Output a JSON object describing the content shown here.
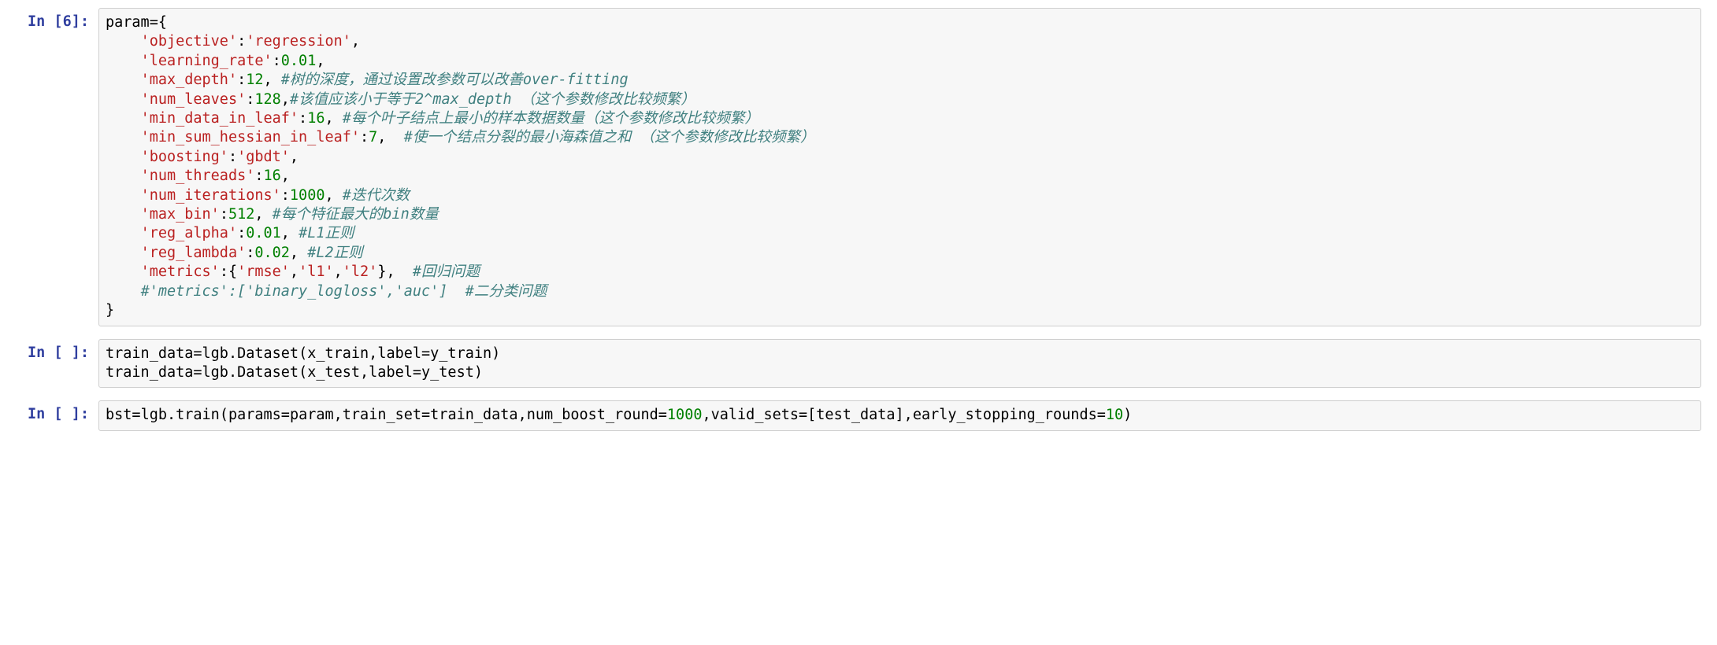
{
  "cells": [
    {
      "prompt_label": "In",
      "prompt_num": "6",
      "lines": [
        [
          {
            "t": "name",
            "v": "param"
          },
          {
            "t": "op",
            "v": "="
          },
          {
            "t": "punct",
            "v": "{"
          }
        ],
        [
          {
            "t": "plain",
            "v": "    "
          },
          {
            "t": "str",
            "v": "'objective'"
          },
          {
            "t": "punct",
            "v": ":"
          },
          {
            "t": "str",
            "v": "'regression'"
          },
          {
            "t": "punct",
            "v": ","
          }
        ],
        [
          {
            "t": "plain",
            "v": "    "
          },
          {
            "t": "str",
            "v": "'learning_rate'"
          },
          {
            "t": "punct",
            "v": ":"
          },
          {
            "t": "num",
            "v": "0.01"
          },
          {
            "t": "punct",
            "v": ","
          }
        ],
        [
          {
            "t": "plain",
            "v": "    "
          },
          {
            "t": "str",
            "v": "'max_depth'"
          },
          {
            "t": "punct",
            "v": ":"
          },
          {
            "t": "num",
            "v": "12"
          },
          {
            "t": "punct",
            "v": ", "
          },
          {
            "t": "comment",
            "v": "#树的深度，通过设置改参数可以改善over-fitting"
          }
        ],
        [
          {
            "t": "plain",
            "v": "    "
          },
          {
            "t": "str",
            "v": "'num_leaves'"
          },
          {
            "t": "punct",
            "v": ":"
          },
          {
            "t": "num",
            "v": "128"
          },
          {
            "t": "punct",
            "v": ","
          },
          {
            "t": "comment",
            "v": "#该值应该小于等于2^max_depth （这个参数修改比较频繁）"
          }
        ],
        [
          {
            "t": "plain",
            "v": "    "
          },
          {
            "t": "str",
            "v": "'min_data_in_leaf'"
          },
          {
            "t": "punct",
            "v": ":"
          },
          {
            "t": "num",
            "v": "16"
          },
          {
            "t": "punct",
            "v": ", "
          },
          {
            "t": "comment",
            "v": "#每个叶子结点上最小的样本数据数量（这个参数修改比较频繁）"
          }
        ],
        [
          {
            "t": "plain",
            "v": "    "
          },
          {
            "t": "str",
            "v": "'min_sum_hessian_in_leaf'"
          },
          {
            "t": "punct",
            "v": ":"
          },
          {
            "t": "num",
            "v": "7"
          },
          {
            "t": "punct",
            "v": ",  "
          },
          {
            "t": "comment",
            "v": "#使一个结点分裂的最小海森值之和 （这个参数修改比较频繁）"
          }
        ],
        [
          {
            "t": "plain",
            "v": "    "
          },
          {
            "t": "str",
            "v": "'boosting'"
          },
          {
            "t": "punct",
            "v": ":"
          },
          {
            "t": "str",
            "v": "'gbdt'"
          },
          {
            "t": "punct",
            "v": ","
          }
        ],
        [
          {
            "t": "plain",
            "v": "    "
          },
          {
            "t": "str",
            "v": "'num_threads'"
          },
          {
            "t": "punct",
            "v": ":"
          },
          {
            "t": "num",
            "v": "16"
          },
          {
            "t": "punct",
            "v": ","
          }
        ],
        [
          {
            "t": "plain",
            "v": "    "
          },
          {
            "t": "str",
            "v": "'num_iterations'"
          },
          {
            "t": "punct",
            "v": ":"
          },
          {
            "t": "num",
            "v": "1000"
          },
          {
            "t": "punct",
            "v": ", "
          },
          {
            "t": "comment",
            "v": "#迭代次数"
          }
        ],
        [
          {
            "t": "plain",
            "v": "    "
          },
          {
            "t": "str",
            "v": "'max_bin'"
          },
          {
            "t": "punct",
            "v": ":"
          },
          {
            "t": "num",
            "v": "512"
          },
          {
            "t": "punct",
            "v": ", "
          },
          {
            "t": "comment",
            "v": "#每个特征最大的bin数量"
          }
        ],
        [
          {
            "t": "plain",
            "v": "    "
          },
          {
            "t": "str",
            "v": "'reg_alpha'"
          },
          {
            "t": "punct",
            "v": ":"
          },
          {
            "t": "num",
            "v": "0.01"
          },
          {
            "t": "punct",
            "v": ", "
          },
          {
            "t": "comment",
            "v": "#L1正则"
          }
        ],
        [
          {
            "t": "plain",
            "v": "    "
          },
          {
            "t": "str",
            "v": "'reg_lambda'"
          },
          {
            "t": "punct",
            "v": ":"
          },
          {
            "t": "num",
            "v": "0.02"
          },
          {
            "t": "punct",
            "v": ", "
          },
          {
            "t": "comment",
            "v": "#L2正则"
          }
        ],
        [
          {
            "t": "plain",
            "v": "    "
          },
          {
            "t": "str",
            "v": "'metrics'"
          },
          {
            "t": "punct",
            "v": ":{"
          },
          {
            "t": "str",
            "v": "'rmse'"
          },
          {
            "t": "punct",
            "v": ","
          },
          {
            "t": "str",
            "v": "'l1'"
          },
          {
            "t": "punct",
            "v": ","
          },
          {
            "t": "str",
            "v": "'l2'"
          },
          {
            "t": "punct",
            "v": "},  "
          },
          {
            "t": "comment",
            "v": "#回归问题"
          }
        ],
        [
          {
            "t": "plain",
            "v": "    "
          },
          {
            "t": "comment",
            "v": "#'metrics':['binary_logloss','auc']  #二分类问题"
          }
        ],
        [
          {
            "t": "punct",
            "v": "}"
          }
        ]
      ]
    },
    {
      "prompt_label": "In",
      "prompt_num": " ",
      "lines": [
        [
          {
            "t": "name",
            "v": "train_data"
          },
          {
            "t": "op",
            "v": "="
          },
          {
            "t": "name",
            "v": "lgb"
          },
          {
            "t": "op",
            "v": "."
          },
          {
            "t": "name",
            "v": "Dataset"
          },
          {
            "t": "punct",
            "v": "("
          },
          {
            "t": "name",
            "v": "x_train"
          },
          {
            "t": "punct",
            "v": ","
          },
          {
            "t": "name",
            "v": "label"
          },
          {
            "t": "op",
            "v": "="
          },
          {
            "t": "name",
            "v": "y_train"
          },
          {
            "t": "punct",
            "v": ")"
          }
        ],
        [
          {
            "t": "name",
            "v": "train_data"
          },
          {
            "t": "op",
            "v": "="
          },
          {
            "t": "name",
            "v": "lgb"
          },
          {
            "t": "op",
            "v": "."
          },
          {
            "t": "name",
            "v": "Dataset"
          },
          {
            "t": "punct",
            "v": "("
          },
          {
            "t": "name",
            "v": "x_test"
          },
          {
            "t": "punct",
            "v": ","
          },
          {
            "t": "name",
            "v": "label"
          },
          {
            "t": "op",
            "v": "="
          },
          {
            "t": "name",
            "v": "y_test"
          },
          {
            "t": "punct",
            "v": ")"
          }
        ]
      ]
    },
    {
      "prompt_label": "In",
      "prompt_num": " ",
      "lines": [
        [
          {
            "t": "name",
            "v": "bst"
          },
          {
            "t": "op",
            "v": "="
          },
          {
            "t": "name",
            "v": "lgb"
          },
          {
            "t": "op",
            "v": "."
          },
          {
            "t": "name",
            "v": "train"
          },
          {
            "t": "punct",
            "v": "("
          },
          {
            "t": "name",
            "v": "params"
          },
          {
            "t": "op",
            "v": "="
          },
          {
            "t": "name",
            "v": "param"
          },
          {
            "t": "punct",
            "v": ","
          },
          {
            "t": "name",
            "v": "train_set"
          },
          {
            "t": "op",
            "v": "="
          },
          {
            "t": "name",
            "v": "train_data"
          },
          {
            "t": "punct",
            "v": ","
          },
          {
            "t": "name",
            "v": "num_boost_round"
          },
          {
            "t": "op",
            "v": "="
          },
          {
            "t": "num",
            "v": "1000"
          },
          {
            "t": "punct",
            "v": ","
          },
          {
            "t": "name",
            "v": "valid_sets"
          },
          {
            "t": "op",
            "v": "="
          },
          {
            "t": "punct",
            "v": "["
          },
          {
            "t": "name",
            "v": "test_data"
          },
          {
            "t": "punct",
            "v": "],"
          },
          {
            "t": "name",
            "v": "early_stopping_rounds"
          },
          {
            "t": "op",
            "v": "="
          },
          {
            "t": "num",
            "v": "10"
          },
          {
            "t": "punct",
            "v": ")"
          }
        ]
      ]
    }
  ]
}
